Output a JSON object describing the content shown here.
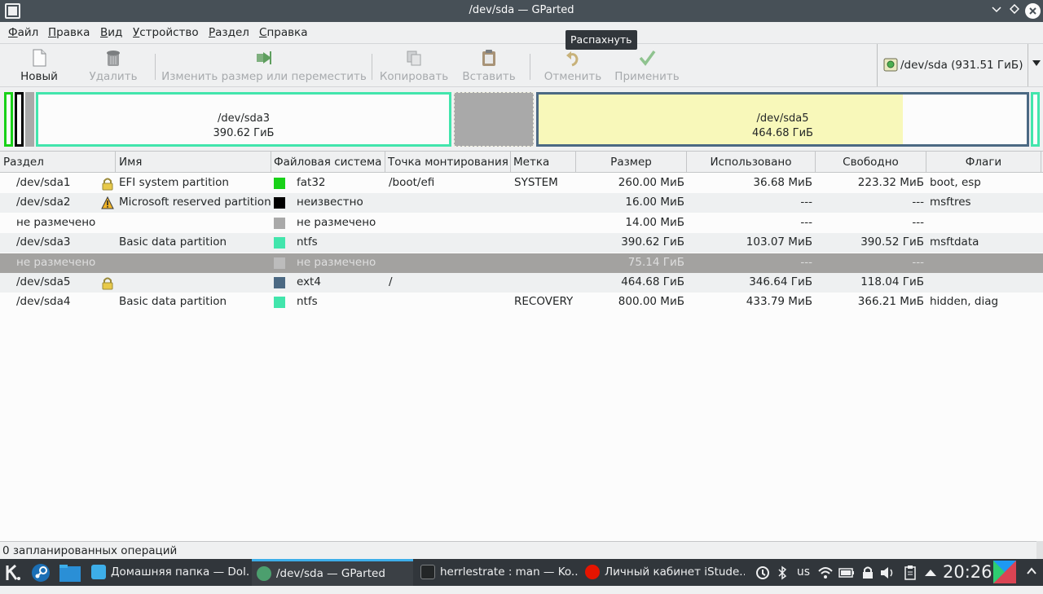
{
  "window": {
    "title": "/dev/sda — GParted"
  },
  "menu": [
    {
      "label": "Файл",
      "key": "Ф",
      "rest": "айл"
    },
    {
      "label": "Правка",
      "key": "П",
      "rest": "равка"
    },
    {
      "label": "Вид",
      "key": "В",
      "rest": "ид"
    },
    {
      "label": "Устройство",
      "key": "У",
      "rest": "стройство"
    },
    {
      "label": "Раздел",
      "key": "Р",
      "rest": "аздел"
    },
    {
      "label": "Справка",
      "key": "С",
      "rest": "правка"
    }
  ],
  "toolbar": {
    "new": "Новый",
    "delete": "Удалить",
    "resize": "Изменить размер или переместить",
    "copy": "Копировать",
    "paste": "Вставить",
    "undo": "Отменить",
    "apply": "Применить"
  },
  "tooltip": "Распахнуть",
  "device": {
    "label": "/dev/sda  (931.51 ГиБ)"
  },
  "diskmap": {
    "sda3": {
      "name": "/dev/sda3",
      "size": "390.62 ГиБ"
    },
    "sda5": {
      "name": "/dev/sda5",
      "size": "464.68 ГиБ",
      "used_fraction": 0.746
    }
  },
  "table": {
    "headers": [
      "Раздел",
      "Имя",
      "Файловая система",
      "Точка монтирования",
      "Метка",
      "Размер",
      "Использовано",
      "Свободно",
      "Флаги"
    ],
    "rows": [
      {
        "partition": "/dev/sda1",
        "icon": "lock-icon",
        "name": "EFI system partition",
        "fs": "fat32",
        "fs_color": "#18d118",
        "mount": "/boot/efi",
        "label": "SYSTEM",
        "size": "260.00 МиБ",
        "used": "36.68 МиБ",
        "free": "223.32 МиБ",
        "flags": "boot, esp"
      },
      {
        "partition": "/dev/sda2",
        "icon": "warning-icon",
        "name": "Microsoft reserved partition",
        "fs": "неизвестно",
        "fs_color": "#000000",
        "mount": "",
        "label": "",
        "size": "16.00 МиБ",
        "used": "---",
        "free": "---",
        "flags": "msftres"
      },
      {
        "partition": "не размечено",
        "icon": "",
        "name": "",
        "fs": "не размечено",
        "fs_color": "#a9a9a9",
        "mount": "",
        "label": "",
        "size": "14.00 МиБ",
        "used": "---",
        "free": "---",
        "flags": ""
      },
      {
        "partition": "/dev/sda3",
        "icon": "",
        "name": "Basic data partition",
        "fs": "ntfs",
        "fs_color": "#42e5ac",
        "mount": "",
        "label": "",
        "size": "390.62 ГиБ",
        "used": "103.07 МиБ",
        "free": "390.52 ГиБ",
        "flags": "msftdata"
      },
      {
        "partition": "не размечено",
        "icon": "",
        "name": "",
        "fs": "не размечено",
        "fs_color": "#a9a9a9",
        "mount": "",
        "label": "",
        "size": "75.14 ГиБ",
        "used": "---",
        "free": "---",
        "flags": ""
      },
      {
        "partition": "/dev/sda5",
        "icon": "lock-icon",
        "name": "",
        "fs": "ext4",
        "fs_color": "#4b6983",
        "mount": "/",
        "label": "",
        "size": "464.68 ГиБ",
        "used": "346.64 ГиБ",
        "free": "118.04 ГиБ",
        "flags": ""
      },
      {
        "partition": "/dev/sda4",
        "icon": "",
        "name": "Basic data partition",
        "fs": "ntfs",
        "fs_color": "#42e5ac",
        "mount": "",
        "label": "RECOVERY",
        "size": "800.00 МиБ",
        "used": "433.79 МиБ",
        "free": "366.21 МиБ",
        "flags": "hidden, diag"
      }
    ],
    "selected_row": 4
  },
  "status": "0 запланированных операций",
  "taskbar": {
    "tasks": [
      "Домашняя папка — Dol...",
      "/dev/sda — GParted",
      "herrlestrate : man — Ko...",
      "Личный кабинет iStude..."
    ],
    "layout": "us",
    "clock": "20:26"
  },
  "colors": {
    "titlebar": "#475057",
    "taskbar": "#31363b",
    "selection": "#a3a2a0",
    "ntfs": "#42e5ac",
    "ext4": "#4b6983",
    "fat32": "#18d118",
    "unallocated": "#a9a9a9",
    "used": "#f8f8ba"
  }
}
